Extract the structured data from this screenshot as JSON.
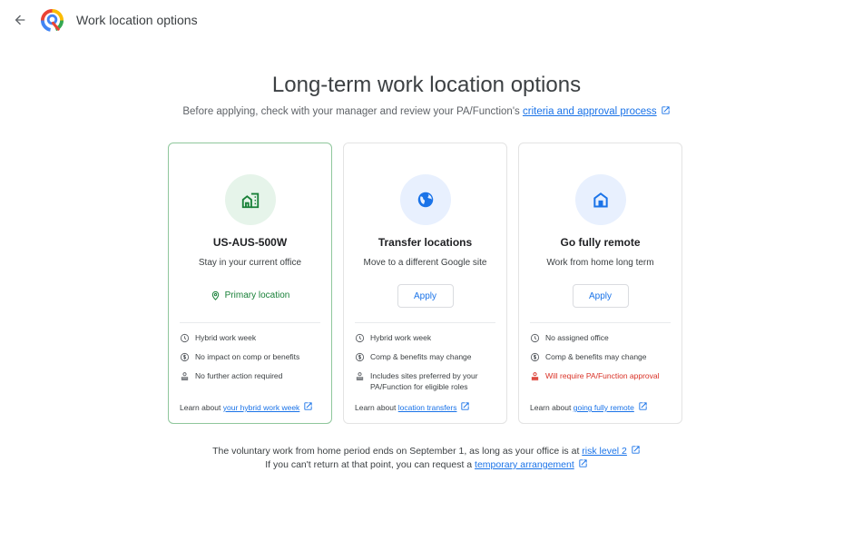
{
  "header": {
    "back_icon": "arrow-back-icon",
    "logo": "google-work-location-logo",
    "title": "Work location options"
  },
  "main": {
    "title": "Long-term work location options",
    "subtitle_prefix": "Before applying, check with your manager and review your PA/Function's ",
    "subtitle_link": "criteria and approval process",
    "subtitle_link_icon": "external-link-icon"
  },
  "cards": [
    {
      "icon": "office-building-icon",
      "title": "US-AUS-500W",
      "description": "Stay in your current office",
      "status_label": "Primary location",
      "status_icon": "location-pin-icon",
      "status_color": "#188038",
      "selected": true,
      "features": [
        {
          "icon": "clock-icon",
          "text": "Hybrid work week"
        },
        {
          "icon": "dollar-icon",
          "text": "No impact on comp or benefits"
        },
        {
          "icon": "person-badge-icon",
          "text": "No further action required"
        }
      ],
      "learn_prefix": "Learn about ",
      "learn_link": "your hybrid work week"
    },
    {
      "icon": "globe-icon",
      "title": "Transfer locations",
      "description": "Move to a different Google site",
      "button_label": "Apply",
      "selected": false,
      "features": [
        {
          "icon": "clock-icon",
          "text": "Hybrid work week"
        },
        {
          "icon": "dollar-icon",
          "text": "Comp & benefits may change"
        },
        {
          "icon": "person-badge-icon",
          "text": "Includes sites preferred by your PA/Function for eligible roles"
        }
      ],
      "learn_prefix": "Learn about ",
      "learn_link": "location transfers"
    },
    {
      "icon": "home-icon",
      "title": "Go fully remote",
      "description": "Work from home long term",
      "button_label": "Apply",
      "selected": false,
      "features": [
        {
          "icon": "clock-icon",
          "text": "No assigned office"
        },
        {
          "icon": "dollar-icon",
          "text": "Comp & benefits may change"
        },
        {
          "icon": "person-badge-icon",
          "text": "Will require PA/Function approval",
          "warning": true,
          "color": "#d93025"
        }
      ],
      "learn_prefix": "Learn about ",
      "learn_link": "going fully remote"
    }
  ],
  "footer": {
    "line1_prefix": "The voluntary work from home period ends on September 1, as long as your office is at ",
    "line1_link": "risk level 2",
    "line2_prefix": "If you can't return at that point, you can request a ",
    "line2_link": "temporary arrangement"
  },
  "colors": {
    "accent_blue": "#1a73e8",
    "success_green": "#188038",
    "warning_red": "#d93025",
    "selected_border": "#8fc79c"
  }
}
